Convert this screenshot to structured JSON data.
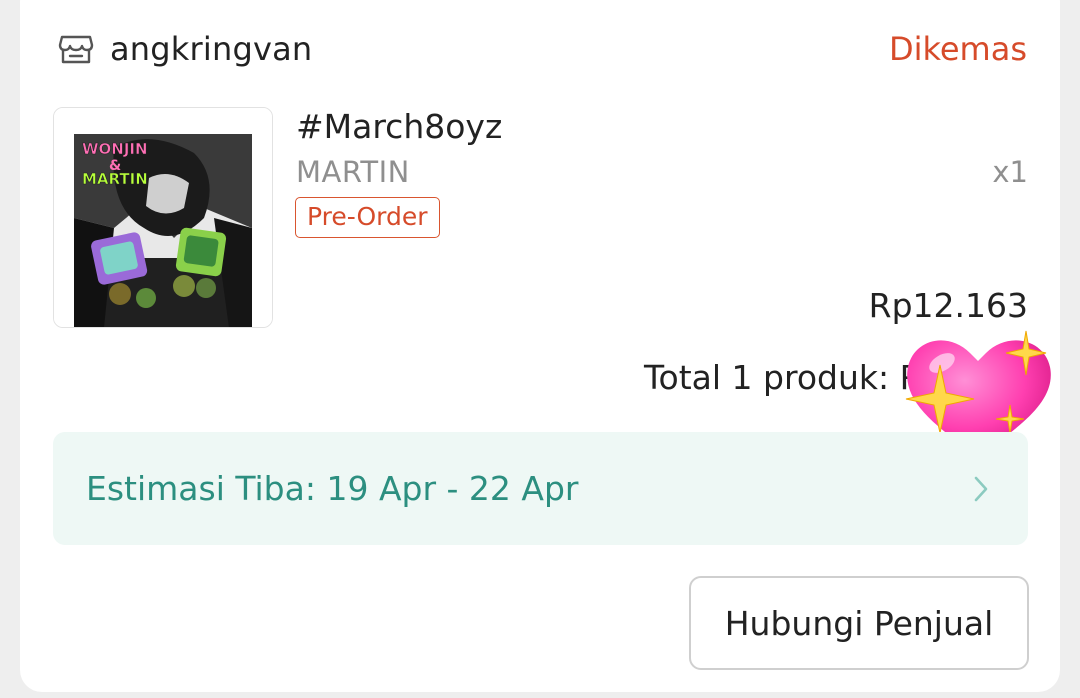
{
  "shop": {
    "icon": "store-icon",
    "name": "angkringvan"
  },
  "order": {
    "status": "Dikemas"
  },
  "product": {
    "name": "#March8oyz",
    "variant": "MARTIN",
    "quantity": "x1",
    "badge": "Pre-Order",
    "price": "Rp12.163",
    "thumb_text": {
      "line1": "WONJIN",
      "line2": "&",
      "line3": "MARTIN"
    }
  },
  "summary": {
    "total_label": "Total 1 produk: R"
  },
  "delivery": {
    "estimate": "Estimasi Tiba: 19 Apr - 22 Apr",
    "chevron": "chevron-right-icon"
  },
  "actions": {
    "contact_seller": "Hubungi Penjual"
  },
  "sticker": {
    "icon": "sparkling-heart-icon"
  },
  "colors": {
    "status": "#d64b2a",
    "badge": "#d9552f",
    "eta_bg": "#eef8f5",
    "eta_text": "#2c8f80",
    "heart": "#ff3fb0"
  }
}
